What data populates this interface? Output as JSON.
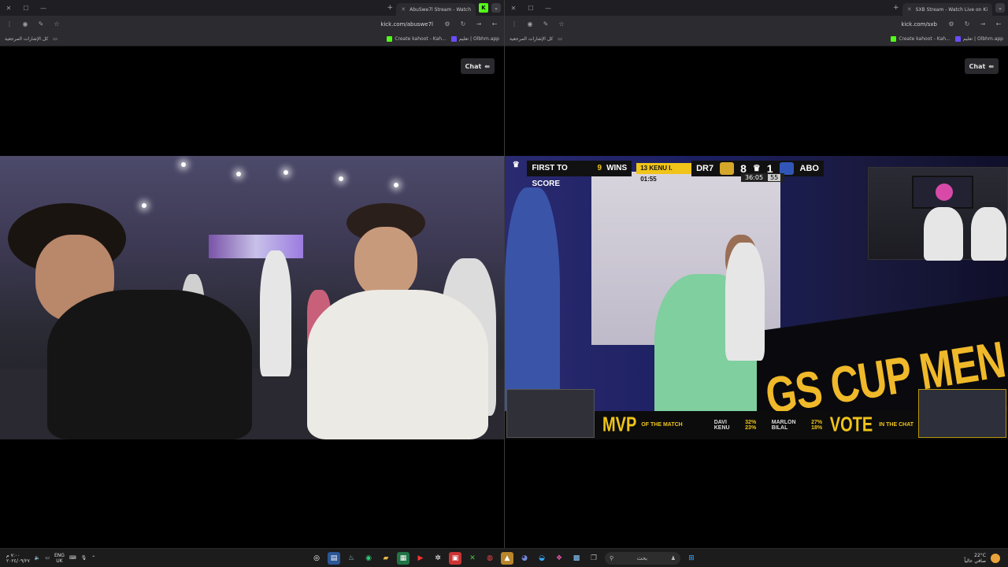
{
  "left_window": {
    "tab_title": "AbuSwe7l Stream - Watch",
    "url": "kick.com/abuswe7l",
    "bookmarks": [
      "كل الإشارات المرجعية",
      "Create kahoot - Kah...",
      "تعليم | Olbhm.app"
    ],
    "chat_label": "Chat"
  },
  "right_window": {
    "tab_title": "SXB Stream - Watch Live on Ki",
    "url": "kick.com/sxb",
    "bookmarks": [
      "كل الإشارات المرجعية",
      "Create kahoot - Kah...",
      "تعليم | Olbhm.app"
    ],
    "chat_label": "Chat"
  },
  "overlay": {
    "first_to_score": "FIRST TO SCORE",
    "target": "9",
    "wins": "WINS",
    "match_info": "13 KENU I. 01:55",
    "team_a": "DR7",
    "score_a": "8",
    "score_b": "1",
    "team_b": "ABO",
    "clock": "36:05",
    "clock_extra": "55",
    "banner": "GS CUP MENA",
    "mvp": "MVP",
    "of_the_match": "OF THE MATCH",
    "vote": "VOTE",
    "in_the_chat": "IN THE CHAT",
    "candidates": [
      {
        "name": "DAVI",
        "pct": "32%"
      },
      {
        "name": "MARLON",
        "pct": "27%"
      },
      {
        "name": "KENU",
        "pct": "23%"
      },
      {
        "name": "BILAL",
        "pct": "18%"
      }
    ]
  },
  "taskbar": {
    "time": "٧:٠٠ م",
    "date": "٢٠٢٤/٠٩/٢٧",
    "lang_top": "ENG",
    "lang_bottom": "UK",
    "search_placeholder": "بحث",
    "temp": "22°C",
    "weather": "صافي عالياً"
  }
}
